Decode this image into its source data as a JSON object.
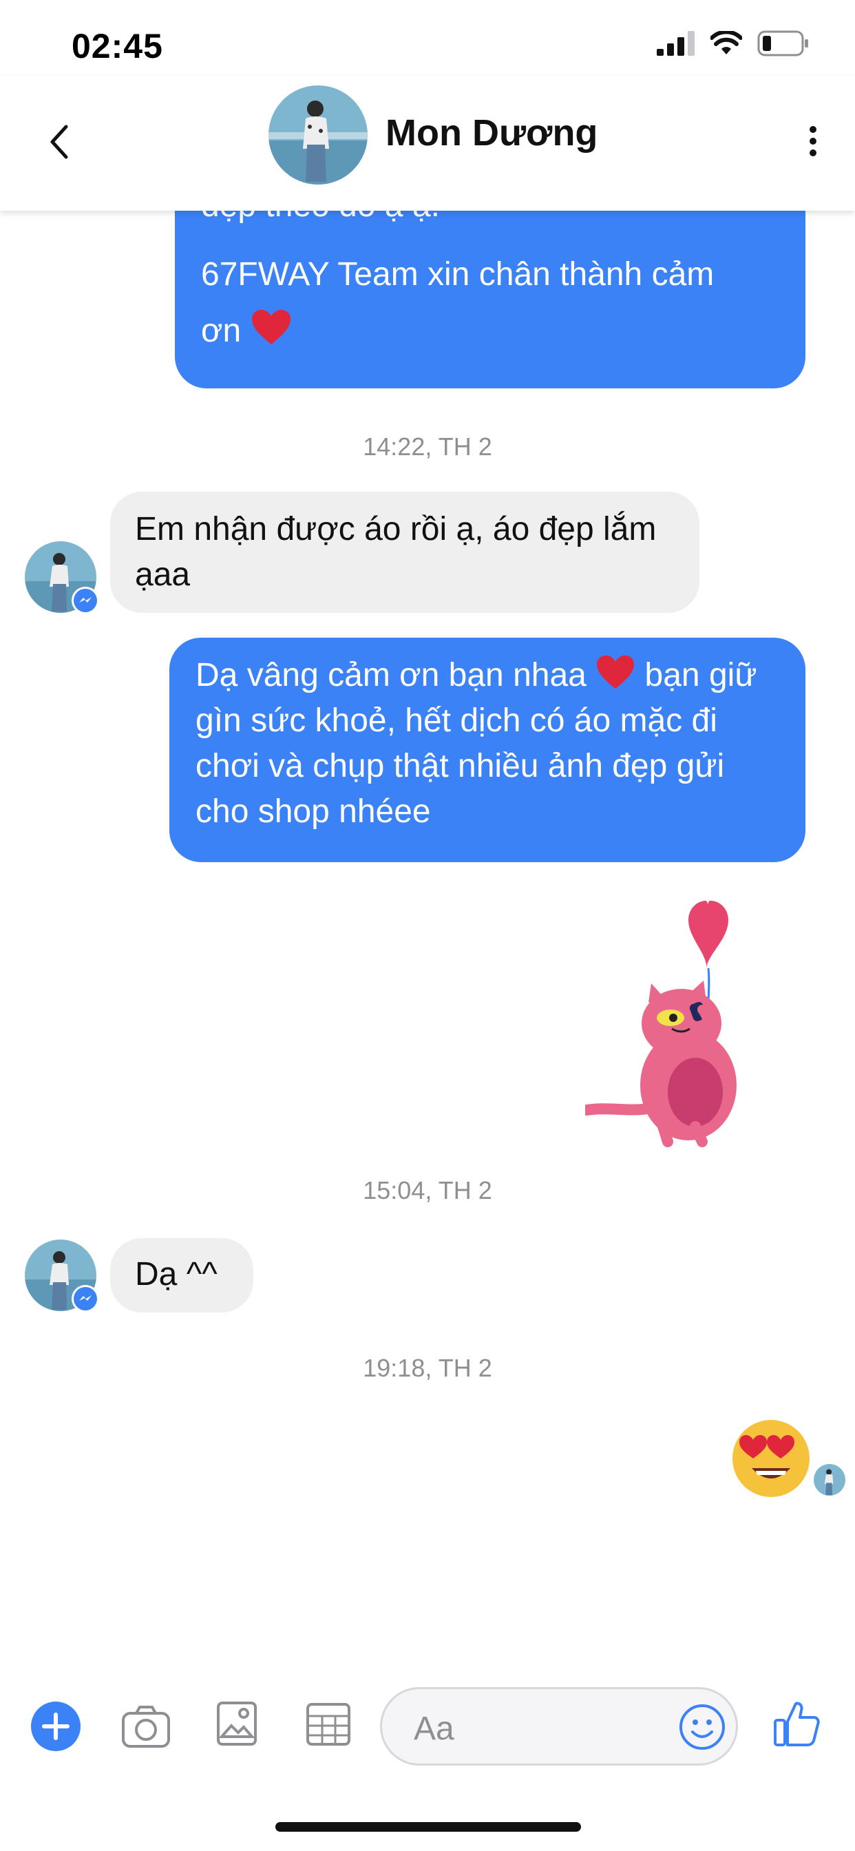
{
  "status_bar": {
    "time": "02:45"
  },
  "header": {
    "contact_name": "Mon Dương"
  },
  "messages": [
    {
      "type": "outgoing",
      "line1": "đẹp theo đó ạ ạ.",
      "line2": "67FWAY Team xin chân thành cảm",
      "line3": "ơn"
    },
    {
      "type": "timestamp",
      "text": "14:22, TH 2"
    },
    {
      "type": "incoming",
      "line1": "Em nhận được áo rồi ạ, áo đẹp lắm",
      "line2": "ạaa"
    },
    {
      "type": "outgoing",
      "line1a": "Dạ vâng cảm ơn bạn nhaa",
      "line1b": "bạn giữ",
      "line2": "gìn sức khoẻ, hết dịch có áo mặc đi",
      "line3": "chơi và chụp thật nhiều ảnh đẹp gửi",
      "line4": "cho shop nhéee"
    },
    {
      "type": "sticker",
      "name": "pink-cat-heart-balloon-sticker"
    },
    {
      "type": "timestamp",
      "text": "15:04, TH 2"
    },
    {
      "type": "incoming",
      "text": "Dạ ^^"
    },
    {
      "type": "timestamp",
      "text": "19:18, TH 2"
    },
    {
      "type": "emoji",
      "name": "heart-eyes-emoji"
    }
  ],
  "composer": {
    "placeholder": "Aa"
  },
  "colors": {
    "accent": "#3b82f6",
    "incoming_bubble": "#efefef",
    "timestamp": "#8e8e93",
    "heart": "#e0263a"
  },
  "icons": [
    "back-icon",
    "more-vertical-icon",
    "plus-icon",
    "camera-icon",
    "image-icon",
    "gif-grid-icon",
    "smiley-icon",
    "like-thumb-icon",
    "messenger-badge-icon"
  ]
}
